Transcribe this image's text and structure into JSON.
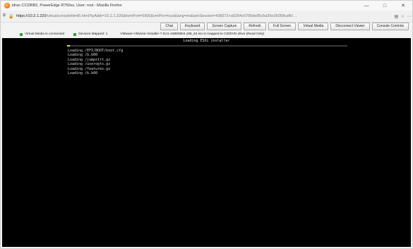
{
  "window": {
    "title": "idrac-CCDRB2, PowerEdge R750xs, User: root - Mozilla Firefox"
  },
  "urlbar": {
    "host": "https://10.2.1.220",
    "path": "/virtualconsolehtml5.html?ipAddr=10.2.1.220&kvmPort=5900&vmPriv=true&lang=en&aimSession=438372+a5264c6700de85c5a35e26058caf6/…"
  },
  "toolbar": {
    "buttons": [
      "Chat",
      "Keyboard",
      "Screen Capture",
      "Refresh",
      "Full Screen",
      "Virtual Media",
      "Disconnect Viewer",
      "Console Controls"
    ]
  },
  "status": {
    "virtual_media": "Virtual Media is connected",
    "devices_mapped": "Devices Mapped: 1",
    "iso_message": "VMware-VMvisor-Installer-7.0U1-16850804.x86_64.iso is mapped to CD/DVD drive (Read Only)",
    "indicator_color": "#2aa02a"
  },
  "console": {
    "title": "Loading ESXi installer",
    "progress": 0.01,
    "lines": [
      "Loading /EFI/BOOT/boot.cfg",
      "Loading /b.b00",
      "Loading /jumpstrt.gz",
      "Loading /useropts.gz",
      "Loading /features.gz",
      "Loading /k.b00"
    ]
  }
}
